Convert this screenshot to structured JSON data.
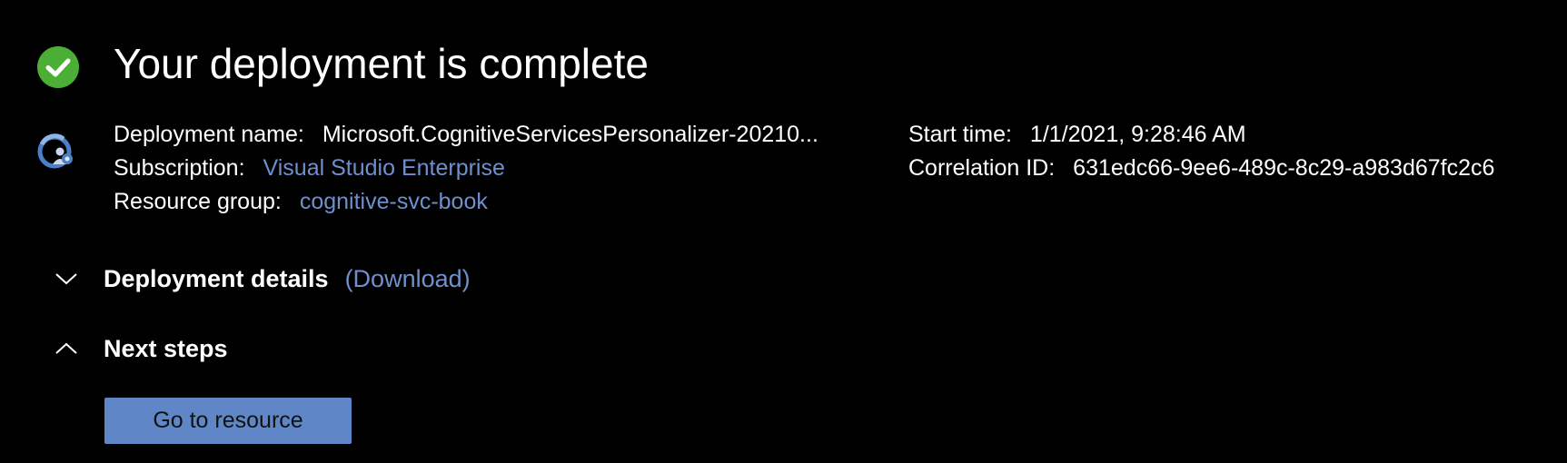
{
  "header": {
    "title": "Your deployment is complete",
    "status_icon": "check-circle-icon",
    "status_color": "#4caf35"
  },
  "deployment": {
    "icon": "deployment-icon",
    "name_label": "Deployment name:",
    "name_value": "Microsoft.CognitiveServicesPersonalizer-20210...",
    "subscription_label": "Subscription:",
    "subscription_value": "Visual Studio Enterprise",
    "resource_group_label": "Resource group:",
    "resource_group_value": "cognitive-svc-book",
    "start_time_label": "Start time:",
    "start_time_value": "1/1/2021, 9:28:46 AM",
    "correlation_label": "Correlation ID:",
    "correlation_value": "631edc66-9ee6-489c-8c29-a983d67fc2c6"
  },
  "sections": {
    "details_title": "Deployment details",
    "details_download": "(Download)",
    "details_icon": "chevron-down-icon",
    "next_title": "Next steps",
    "next_icon": "chevron-up-icon"
  },
  "actions": {
    "go_to_resource": "Go to resource"
  },
  "colors": {
    "background": "#000000",
    "link": "#6f8fcf",
    "button": "#5f87c8"
  }
}
